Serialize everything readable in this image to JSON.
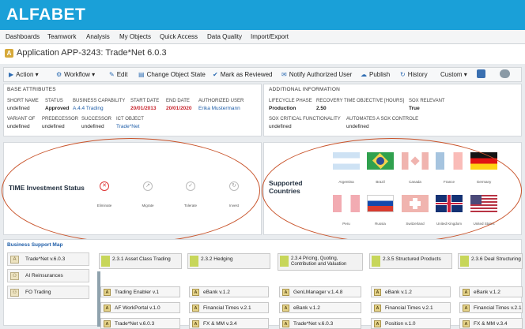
{
  "header": {
    "logo": "ALFABET"
  },
  "menu": [
    "Dashboards",
    "Teamwork",
    "Analysis",
    "My Objects",
    "Quick Access",
    "Data Quality",
    "Import/Export"
  ],
  "page": {
    "icon": "A",
    "title": "Application APP-3243: Trade*Net 6.0.3"
  },
  "toolbar": {
    "action": "Action",
    "workflow": "Workflow",
    "edit": "Edit",
    "change_state": "Change Object State",
    "mark_reviewed": "Mark as Reviewed",
    "notify": "Notify Authorized User",
    "publish": "Publish",
    "history": "History",
    "custom": "Custom"
  },
  "base": {
    "title": "BASE ATTRIBUTES",
    "labels": [
      "SHORT NAME",
      "STATUS",
      "BUSINESS CAPABILITY",
      "START DATE",
      "END DATE",
      "AUTHORIZED USER"
    ],
    "values": [
      "undefined",
      "Approved",
      "A.4.4 Trading",
      "20/01/2013",
      "20/01/2020",
      "Erika Mustermann"
    ],
    "labels2": [
      "VARIANT OF",
      "PREDECESSOR",
      "SUCCESSOR",
      "ICT OBJECT"
    ],
    "values2": [
      "undefined",
      "undefined",
      "undefined",
      "Trade*Net"
    ]
  },
  "additional": {
    "title": "ADDITIONAL INFORMATION",
    "labels": [
      "LIFECYCLE PHASE",
      "RECOVERY TIME OBJECTIVE [HOURS]",
      "SOX RELEVANT"
    ],
    "values": [
      "Production",
      "2.50",
      "True"
    ],
    "labels2": [
      "SOX CRITICAL FUNCTIONALITY",
      "AUTOMATES A SOX CONTROLE"
    ],
    "values2": [
      "undefined",
      "undefined"
    ]
  },
  "time": {
    "title": "TIME Investment Status",
    "items": [
      {
        "label": "Eliminate",
        "icon": "close-icon",
        "active": true
      },
      {
        "label": "Migrate",
        "icon": "migrate-icon",
        "active": false
      },
      {
        "label": "Tolerate",
        "icon": "check-icon",
        "active": false
      },
      {
        "label": "Invest",
        "icon": "invest-icon",
        "active": false
      }
    ]
  },
  "countries": {
    "title_line1": "Supported",
    "title_line2": "Countries",
    "flags": [
      {
        "name": "Argentina",
        "active": false
      },
      {
        "name": "Brazil",
        "active": true
      },
      {
        "name": "Canada",
        "active": false
      },
      {
        "name": "France",
        "active": false
      },
      {
        "name": "Germany",
        "active": true
      },
      {
        "name": "Peru",
        "active": false
      },
      {
        "name": "Russia",
        "active": true
      },
      {
        "name": "Switzerland",
        "active": false
      },
      {
        "name": "United Kingdom",
        "active": true
      },
      {
        "name": "United States",
        "active": true
      }
    ]
  },
  "bsm": {
    "title": "Business Support Map",
    "left": [
      "Trade*Net v.6.0.3",
      "AI Reinsurances",
      "FO Trading"
    ],
    "columns": [
      {
        "head": "2.3.1 Asset Class Trading",
        "items": [
          "Trading Enabler v.1",
          "AF WorkPortal v.1.0",
          "Trade*Net v.6.0.3"
        ]
      },
      {
        "head": "2.3.2 Hedging",
        "items": [
          "eBank v.1.2",
          "Financial Times v.2.1",
          "FX & MM v.3.4"
        ]
      },
      {
        "head": "2.3.4 Pricing, Quoting, Contribution and Valuation",
        "items": [
          "GenLManager v.1.4.8",
          "eBank v.1.2",
          "Trade*Net v.6.0.3"
        ]
      },
      {
        "head": "2.3.5 Structured Products",
        "items": [
          "eBank v.1.2",
          "Financial Times v.2.1",
          "Position v.1.0"
        ]
      },
      {
        "head": "2.3.6 Deal Structuring",
        "items": [
          "eBank v.1.2",
          "Financial Times v.2.1",
          "FX & MM v.3.4"
        ]
      }
    ]
  }
}
